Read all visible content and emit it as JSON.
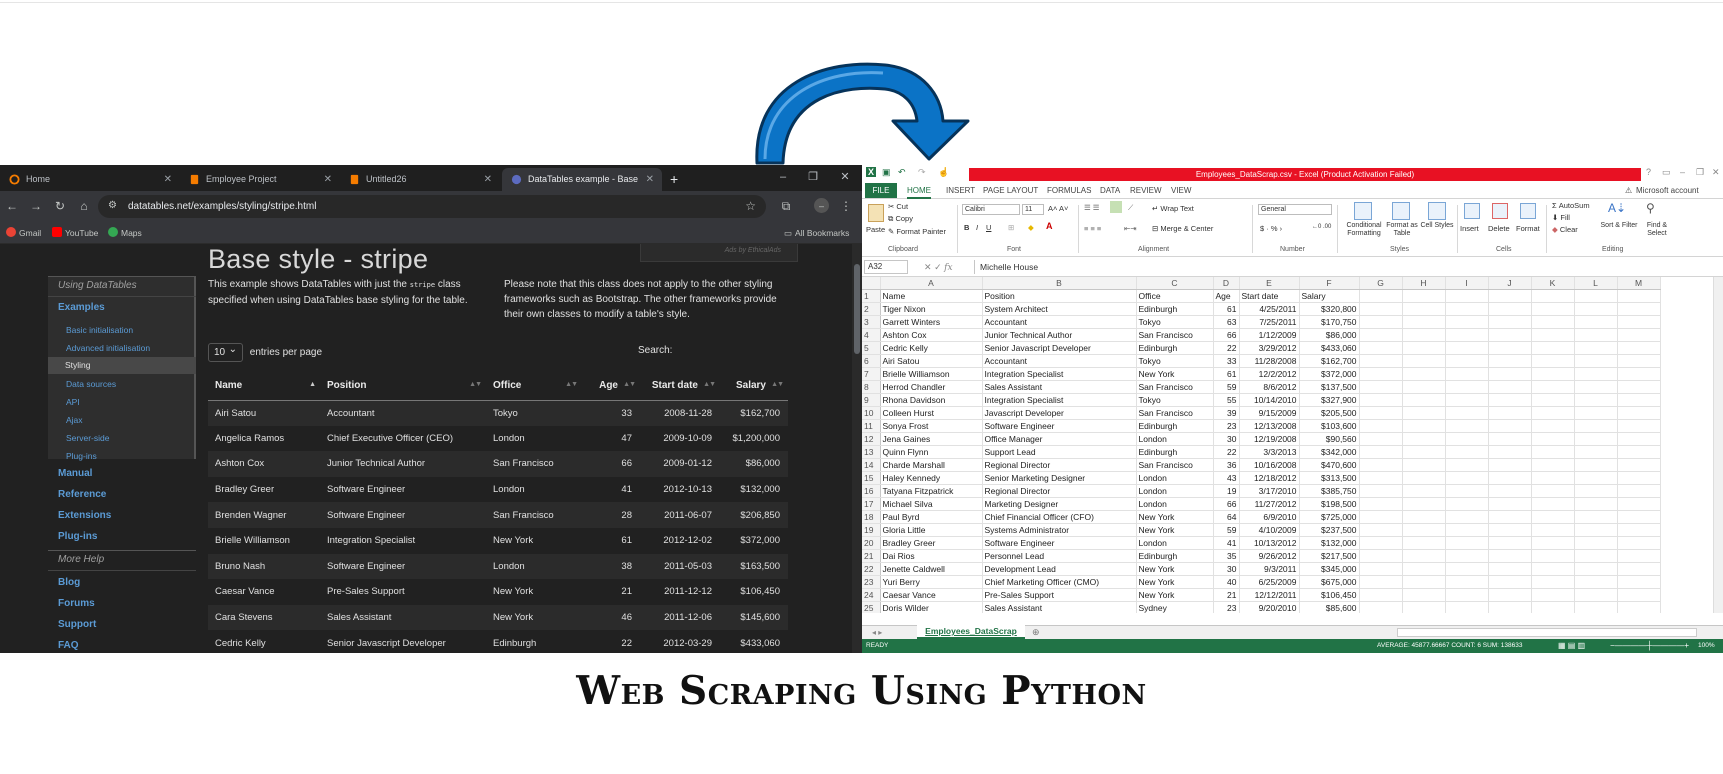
{
  "caption": "Web Scraping Using Python",
  "browser": {
    "tabs": [
      {
        "label": "Home",
        "icon": "home-ring-icon"
      },
      {
        "label": "Employee Project",
        "icon": "document-icon"
      },
      {
        "label": "Untitled26",
        "icon": "document-icon"
      },
      {
        "label": "DataTables example - Base style",
        "icon": "datatables-icon"
      }
    ],
    "url": "datatables.net/examples/styling/stripe.html",
    "bookmarks": [
      "Gmail",
      "YouTube",
      "Maps"
    ],
    "all_bookmarks": "All Bookmarks",
    "sidebar": {
      "section1": "Using DataTables",
      "examples": "Examples",
      "sub_items": [
        "Basic initialisation",
        "Advanced initialisation",
        "Styling",
        "Data sources",
        "API",
        "Ajax",
        "Server-side",
        "Plug-ins"
      ],
      "main_items": [
        "Manual",
        "Reference",
        "Extensions",
        "Plug-ins"
      ],
      "section2": "More Help",
      "help_items": [
        "Blog",
        "Forums",
        "Support",
        "FAQ"
      ]
    },
    "page": {
      "title": "Base style - stripe",
      "ad_text": "Ads by EthicalAds",
      "desc_left_1": "This example shows DataTables with just the",
      "desc_code": "stripe",
      "desc_left_2": "class",
      "desc_left_3": "specified when using DataTables base styling for the table.",
      "desc_right": "Please note that this class does not apply to the other styling frameworks such as Bootstrap. The other frameworks provide their own classes to modify a table's style.",
      "length_value": "10",
      "length_label": "entries per page",
      "search_label": "Search:",
      "columns": [
        "Name",
        "Position",
        "Office",
        "Age",
        "Start date",
        "Salary"
      ],
      "rows": [
        [
          "Airi Satou",
          "Accountant",
          "Tokyo",
          "33",
          "2008-11-28",
          "$162,700"
        ],
        [
          "Angelica Ramos",
          "Chief Executive Officer (CEO)",
          "London",
          "47",
          "2009-10-09",
          "$1,200,000"
        ],
        [
          "Ashton Cox",
          "Junior Technical Author",
          "San Francisco",
          "66",
          "2009-01-12",
          "$86,000"
        ],
        [
          "Bradley Greer",
          "Software Engineer",
          "London",
          "41",
          "2012-10-13",
          "$132,000"
        ],
        [
          "Brenden Wagner",
          "Software Engineer",
          "San Francisco",
          "28",
          "2011-06-07",
          "$206,850"
        ],
        [
          "Brielle Williamson",
          "Integration Specialist",
          "New York",
          "61",
          "2012-12-02",
          "$372,000"
        ],
        [
          "Bruno Nash",
          "Software Engineer",
          "London",
          "38",
          "2011-05-03",
          "$163,500"
        ],
        [
          "Caesar Vance",
          "Pre-Sales Support",
          "New York",
          "21",
          "2011-12-12",
          "$106,450"
        ],
        [
          "Cara Stevens",
          "Sales Assistant",
          "New York",
          "46",
          "2011-12-06",
          "$145,600"
        ],
        [
          "Cedric Kelly",
          "Senior Javascript Developer",
          "Edinburgh",
          "22",
          "2012-03-29",
          "$433,060"
        ]
      ]
    }
  },
  "excel": {
    "title": "Employees_DataScrap.csv - Excel (Product Activation Failed)",
    "menu": [
      "FILE",
      "HOME",
      "INSERT",
      "PAGE LAYOUT",
      "FORMULAS",
      "DATA",
      "REVIEW",
      "VIEW"
    ],
    "account": "Microsoft account",
    "ribbon": {
      "paste": "Paste",
      "cut": "Cut",
      "copy": "Copy",
      "format_painter": "Format Painter",
      "font_name": "Calibri",
      "font_size": "11",
      "wrap_text": "Wrap Text",
      "merge_center": "Merge & Center",
      "number_format": "General",
      "conditional_formatting": "Conditional Formatting",
      "format_as_table": "Format as Table",
      "cell_styles": "Cell Styles",
      "insert": "Insert",
      "delete": "Delete",
      "format": "Format",
      "autosum": "AutoSum",
      "fill": "Fill",
      "clear": "Clear",
      "sort_filter": "Sort & Filter",
      "find_select": "Find & Select",
      "groups": [
        "Clipboard",
        "Font",
        "Alignment",
        "Number",
        "Styles",
        "Cells",
        "Editing"
      ]
    },
    "name_box": "A32",
    "formula_value": "Michelle House",
    "col_headers": [
      "A",
      "B",
      "C",
      "D",
      "E",
      "F",
      "G",
      "H",
      "I",
      "J",
      "K",
      "L",
      "M"
    ],
    "header_row": [
      "Name",
      "Position",
      "Office",
      "Age",
      "Start date",
      "Salary"
    ],
    "rows": [
      [
        "Tiger Nixon",
        "System Architect",
        "Edinburgh",
        "61",
        "4/25/2011",
        "$320,800"
      ],
      [
        "Garrett Winters",
        "Accountant",
        "Tokyo",
        "63",
        "7/25/2011",
        "$170,750"
      ],
      [
        "Ashton Cox",
        "Junior Technical Author",
        "San Francisco",
        "66",
        "1/12/2009",
        "$86,000"
      ],
      [
        "Cedric Kelly",
        "Senior Javascript Developer",
        "Edinburgh",
        "22",
        "3/29/2012",
        "$433,060"
      ],
      [
        "Airi Satou",
        "Accountant",
        "Tokyo",
        "33",
        "11/28/2008",
        "$162,700"
      ],
      [
        "Brielle Williamson",
        "Integration Specialist",
        "New York",
        "61",
        "12/2/2012",
        "$372,000"
      ],
      [
        "Herrod Chandler",
        "Sales Assistant",
        "San Francisco",
        "59",
        "8/6/2012",
        "$137,500"
      ],
      [
        "Rhona Davidson",
        "Integration Specialist",
        "Tokyo",
        "55",
        "10/14/2010",
        "$327,900"
      ],
      [
        "Colleen Hurst",
        "Javascript Developer",
        "San Francisco",
        "39",
        "9/15/2009",
        "$205,500"
      ],
      [
        "Sonya Frost",
        "Software Engineer",
        "Edinburgh",
        "23",
        "12/13/2008",
        "$103,600"
      ],
      [
        "Jena Gaines",
        "Office Manager",
        "London",
        "30",
        "12/19/2008",
        "$90,560"
      ],
      [
        "Quinn Flynn",
        "Support Lead",
        "Edinburgh",
        "22",
        "3/3/2013",
        "$342,000"
      ],
      [
        "Charde Marshall",
        "Regional Director",
        "San Francisco",
        "36",
        "10/16/2008",
        "$470,600"
      ],
      [
        "Haley Kennedy",
        "Senior Marketing Designer",
        "London",
        "43",
        "12/18/2012",
        "$313,500"
      ],
      [
        "Tatyana Fitzpatrick",
        "Regional Director",
        "London",
        "19",
        "3/17/2010",
        "$385,750"
      ],
      [
        "Michael Silva",
        "Marketing Designer",
        "London",
        "66",
        "11/27/2012",
        "$198,500"
      ],
      [
        "Paul Byrd",
        "Chief Financial Officer (CFO)",
        "New York",
        "64",
        "6/9/2010",
        "$725,000"
      ],
      [
        "Gloria Little",
        "Systems Administrator",
        "New York",
        "59",
        "4/10/2009",
        "$237,500"
      ],
      [
        "Bradley Greer",
        "Software Engineer",
        "London",
        "41",
        "10/13/2012",
        "$132,000"
      ],
      [
        "Dai Rios",
        "Personnel Lead",
        "Edinburgh",
        "35",
        "9/26/2012",
        "$217,500"
      ],
      [
        "Jenette Caldwell",
        "Development Lead",
        "New York",
        "30",
        "9/3/2011",
        "$345,000"
      ],
      [
        "Yuri Berry",
        "Chief Marketing Officer (CMO)",
        "New York",
        "40",
        "6/25/2009",
        "$675,000"
      ],
      [
        "Caesar Vance",
        "Pre-Sales Support",
        "New York",
        "21",
        "12/12/2011",
        "$106,450"
      ],
      [
        "Doris Wilder",
        "Sales Assistant",
        "Sydney",
        "23",
        "9/20/2010",
        "$85,600"
      ]
    ],
    "sheet_tab": "Employees_DataScrap",
    "status_ready": "READY",
    "status_stats": "AVERAGE: 45877.66667    COUNT: 6    SUM: 138633",
    "zoom": "100%"
  },
  "colors": {
    "excel_green": "#217346",
    "activation_red": "#e81123",
    "arrow_fill": "#0b73c6",
    "link_blue": "#5b9bd5"
  }
}
